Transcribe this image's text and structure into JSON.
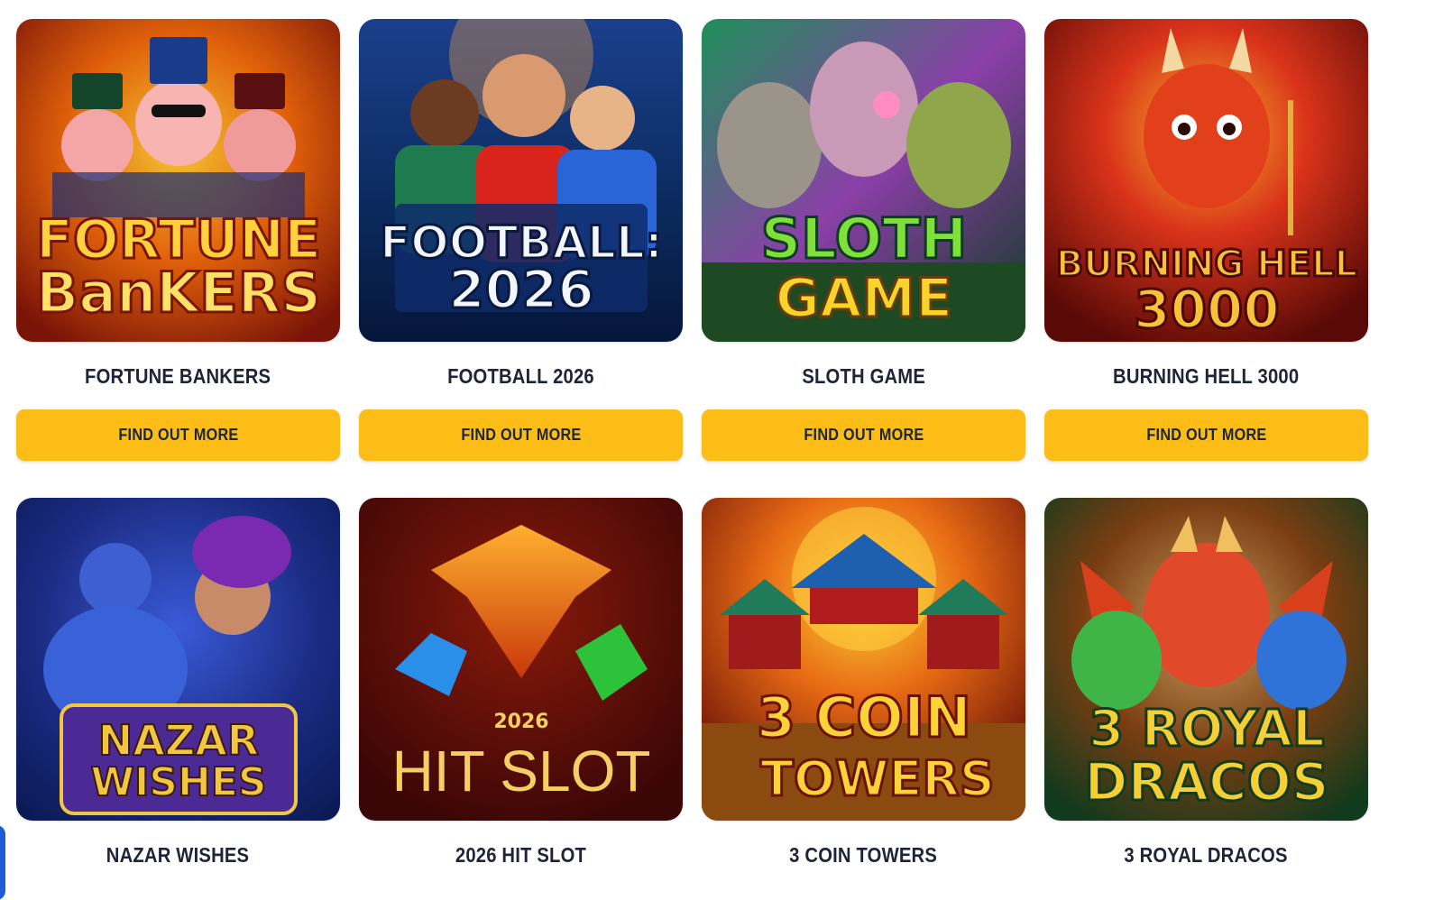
{
  "games": [
    {
      "name": "FORTUNE BANKERS",
      "art_line1": "FORTUNE",
      "art_line2": "BanKERS",
      "art_colors": [
        "#7a1408",
        "#e0600a",
        "#f6c431"
      ],
      "button_label": "FIND OUT MORE"
    },
    {
      "name": "FOOTBALL 2026",
      "art_line1": "FOOTBALL:",
      "art_line2": "2026",
      "art_colors": [
        "#0a2a5c",
        "#1e7b4f",
        "#f3f6ff"
      ],
      "button_label": "FIND OUT MORE"
    },
    {
      "name": "SLOTH GAME",
      "art_line1": "SLOTH",
      "art_line2": "GAME",
      "art_colors": [
        "#0f3a23",
        "#6fbf3b",
        "#f6d42a"
      ],
      "button_label": "FIND OUT MORE"
    },
    {
      "name": "BURNING HELL 3000",
      "art_line1": "BURNING HELL",
      "art_line2": "3000",
      "art_colors": [
        "#5a0a06",
        "#d9331a",
        "#f7b42c"
      ],
      "button_label": "FIND OUT MORE"
    },
    {
      "name": "NAZAR WISHES",
      "art_line1": "NAZAR",
      "art_line2": "WISHES",
      "art_colors": [
        "#0b1a55",
        "#4b2a96",
        "#f3c640"
      ]
    },
    {
      "name": "2026 HIT SLOT",
      "art_line1": "2026",
      "art_line2": "HIT SLOT",
      "art_colors": [
        "#3a0606",
        "#e8731b",
        "#f5cf63"
      ]
    },
    {
      "name": "3 COIN TOWERS",
      "art_line1": "3 COIN",
      "art_line2": "TOWERS",
      "art_colors": [
        "#6b1208",
        "#e86a14",
        "#fbd338"
      ]
    },
    {
      "name": "3 ROYAL DRACOS",
      "art_line1": "3 ROYAL",
      "art_line2": "DRACOS",
      "art_colors": [
        "#123a1c",
        "#7a3d12",
        "#f6cf37"
      ]
    }
  ],
  "colors": {
    "button": "#fdbd17",
    "text": "#1d2538",
    "side_tab": "#1f5bd6"
  }
}
